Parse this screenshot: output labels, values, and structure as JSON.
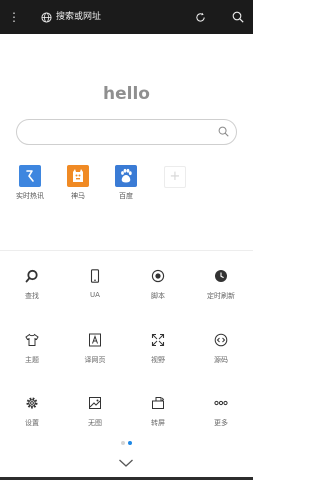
{
  "topbar": {
    "menu_glyph": "⋮",
    "url_placeholder": "搜索或网址",
    "icons": [
      "more-vertical-icon",
      "globe-icon",
      "refresh-icon",
      "search-icon"
    ]
  },
  "logo_text": "hello",
  "search": {
    "value": "",
    "icon": "search-icon"
  },
  "shortcuts": [
    {
      "label": "实时热讯",
      "color": "#3e86df",
      "icon": "trend-arrow-icon"
    },
    {
      "label": "神马",
      "color": "#f08a24",
      "icon": "shenma-horse-icon"
    },
    {
      "label": "百度",
      "color": "#3a7bd5",
      "icon": "baidu-paw-icon"
    }
  ],
  "add_glyph": "+",
  "menu": [
    {
      "label": "查找",
      "icon": "find-icon"
    },
    {
      "label": "UA",
      "icon": "phone-icon"
    },
    {
      "label": "脚本",
      "icon": "script-icon"
    },
    {
      "label": "定时刷新",
      "icon": "clock-icon"
    },
    {
      "label": "主题",
      "icon": "shirt-icon"
    },
    {
      "label": "译网页",
      "icon": "translate-icon"
    },
    {
      "label": "视野",
      "icon": "fullscreen-icon"
    },
    {
      "label": "源码",
      "icon": "code-icon"
    },
    {
      "label": "设置",
      "icon": "gear-icon"
    },
    {
      "label": "无图",
      "icon": "no-image-icon"
    },
    {
      "label": "转屏",
      "icon": "rotate-screen-icon"
    },
    {
      "label": "更多",
      "icon": "more-icon"
    }
  ],
  "pager": {
    "pages": 2,
    "active_index": 1,
    "active_color": "#1e88e5",
    "inactive_color": "#d5d5d5"
  },
  "colors": {
    "topbar": "#1b1b1b",
    "icon": "#333333",
    "label": "#666666"
  }
}
